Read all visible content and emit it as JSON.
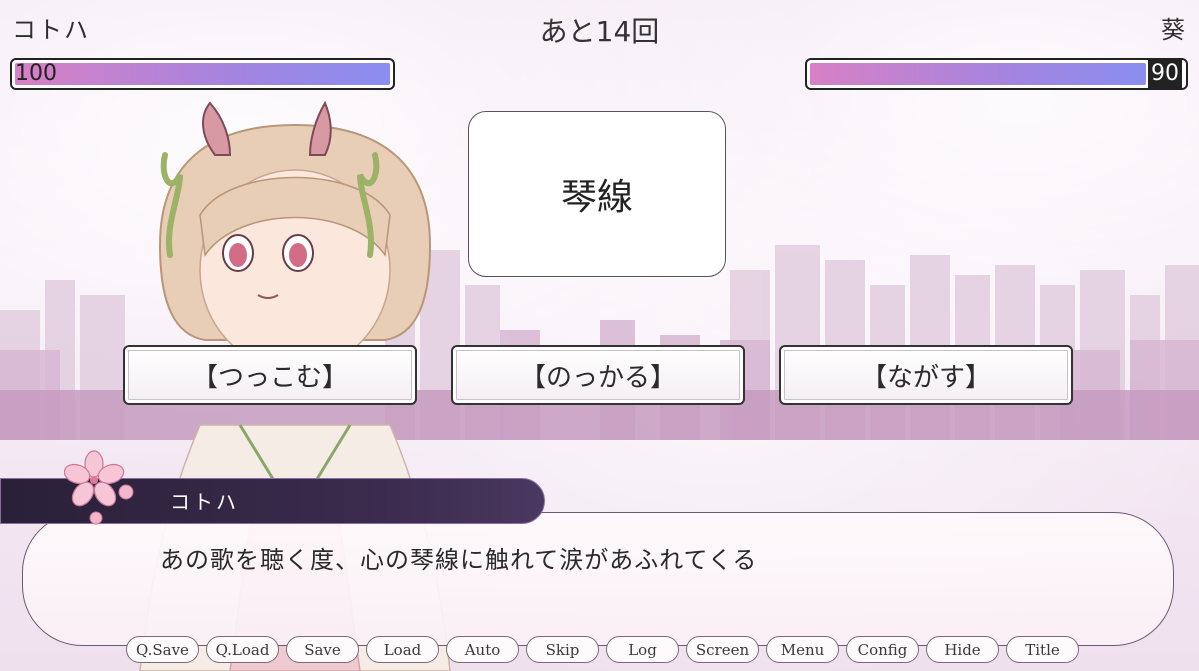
{
  "player_left": {
    "name": "コトハ",
    "hp": "100",
    "hp_fraction": 1.0
  },
  "player_right": {
    "name": "葵",
    "hp": "90",
    "hp_fraction": 0.9
  },
  "counter": "あと14回",
  "prompt_word": "琴線",
  "choices": [
    "【つっこむ】",
    "【のっかる】",
    "【ながす】"
  ],
  "dialogue": {
    "speaker": "コトハ",
    "text": "あの歌を聴く度、心の琴線に触れて涙があふれてくる"
  },
  "quick_menu": [
    "Q.Save",
    "Q.Load",
    "Save",
    "Load",
    "Auto",
    "Skip",
    "Log",
    "Screen",
    "Menu",
    "Config",
    "Hide",
    "Title"
  ],
  "colors": {
    "hp_gradient_start": "#d880c4",
    "hp_gradient_end": "#8a8ef0",
    "namebar": "#2a2038"
  }
}
